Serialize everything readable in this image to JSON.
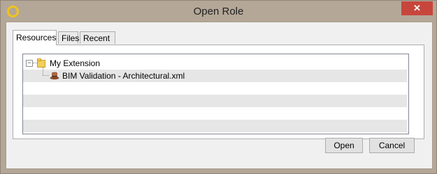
{
  "window": {
    "title": "Open Role",
    "close_glyph": "✕"
  },
  "tabs": [
    {
      "label": "Resources",
      "active": true
    },
    {
      "label": "Files",
      "active": false
    },
    {
      "label": "Recent",
      "active": false
    }
  ],
  "tree": {
    "folder": {
      "label": "My Extension",
      "expander": "−",
      "icon": "folder-icon"
    },
    "items": [
      {
        "label": "BIM Validation - Architectural.xml",
        "icon": "role-hat-icon"
      }
    ]
  },
  "buttons": {
    "open": "Open",
    "cancel": "Cancel"
  },
  "colors": {
    "titlebar": "#b4a797",
    "close": "#c7463c",
    "alt_row": "#e6e6e6"
  }
}
